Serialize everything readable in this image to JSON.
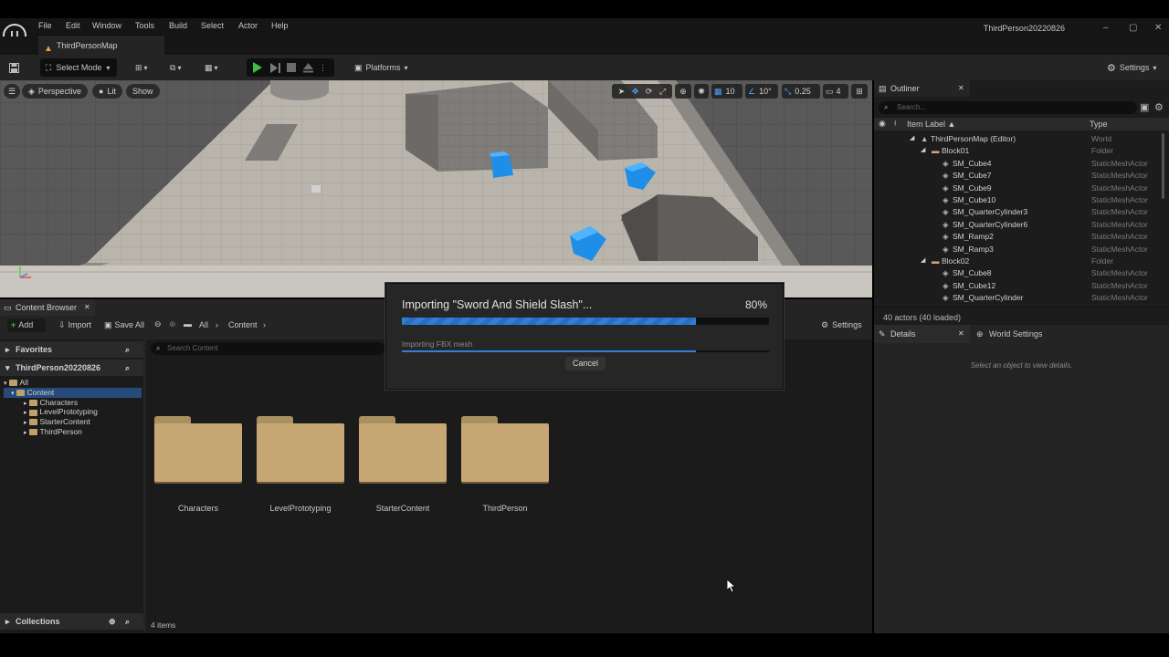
{
  "app": {
    "logo": "U",
    "project_name": "ThirdPerson20220826"
  },
  "menu": [
    "File",
    "Edit",
    "Window",
    "Tools",
    "Build",
    "Select",
    "Actor",
    "Help"
  ],
  "window_controls": {
    "minimize": "–",
    "restore": "▢",
    "close": "✕"
  },
  "map_tab": {
    "label": "ThirdPersonMap",
    "icon": "level-icon"
  },
  "toolbar": {
    "save_icon": "save-icon",
    "mode_label": "Select Mode",
    "platforms_label": "Platforms",
    "settings_label": "Settings"
  },
  "viewport": {
    "perspective_label": "Perspective",
    "lit_label": "Lit",
    "show_label": "Show",
    "grid_snap": "10",
    "rotation_snap": "10°",
    "scale_snap": "0.25",
    "camera_speed": "4"
  },
  "outliner": {
    "tab_label": "Outliner",
    "search_placeholder": "Search...",
    "col_label": "Item Label ▲",
    "col_type": "Type",
    "rows": [
      {
        "label": "ThirdPersonMap (Editor)",
        "type": "World",
        "indent": 0,
        "kind": "world"
      },
      {
        "label": "Block01",
        "type": "Folder",
        "indent": 1,
        "kind": "folder"
      },
      {
        "label": "SM_Cube4",
        "type": "StaticMeshActor",
        "indent": 2,
        "kind": "mesh"
      },
      {
        "label": "SM_Cube7",
        "type": "StaticMeshActor",
        "indent": 2,
        "kind": "mesh"
      },
      {
        "label": "SM_Cube9",
        "type": "StaticMeshActor",
        "indent": 2,
        "kind": "mesh"
      },
      {
        "label": "SM_Cube10",
        "type": "StaticMeshActor",
        "indent": 2,
        "kind": "mesh"
      },
      {
        "label": "SM_QuarterCylinder3",
        "type": "StaticMeshActor",
        "indent": 2,
        "kind": "mesh"
      },
      {
        "label": "SM_QuarterCylinder6",
        "type": "StaticMeshActor",
        "indent": 2,
        "kind": "mesh"
      },
      {
        "label": "SM_Ramp2",
        "type": "StaticMeshActor",
        "indent": 2,
        "kind": "mesh"
      },
      {
        "label": "SM_Ramp3",
        "type": "StaticMeshActor",
        "indent": 2,
        "kind": "mesh"
      },
      {
        "label": "Block02",
        "type": "Folder",
        "indent": 1,
        "kind": "folder"
      },
      {
        "label": "SM_Cube8",
        "type": "StaticMeshActor",
        "indent": 2,
        "kind": "mesh"
      },
      {
        "label": "SM_Cube12",
        "type": "StaticMeshActor",
        "indent": 2,
        "kind": "mesh"
      },
      {
        "label": "SM_QuarterCylinder",
        "type": "StaticMeshActor",
        "indent": 2,
        "kind": "mesh"
      }
    ],
    "status": "40 actors (40 loaded)"
  },
  "details": {
    "tab_label": "Details",
    "world_settings_label": "World Settings",
    "empty_hint": "Select an object to view details."
  },
  "content_browser": {
    "tab_label": "Content Browser",
    "add_label": "Add",
    "import_label": "Import",
    "save_all_label": "Save All",
    "path": [
      "All",
      "Content"
    ],
    "settings_label": "Settings",
    "favorites_label": "Favorites",
    "project_label": "ThirdPerson20220826",
    "search_placeholder": "Search Content",
    "tree": [
      {
        "label": "All",
        "indent": 0,
        "selected": false
      },
      {
        "label": "Content",
        "indent": 1,
        "selected": true
      },
      {
        "label": "Characters",
        "indent": 2,
        "selected": false
      },
      {
        "label": "LevelPrototyping",
        "indent": 2,
        "selected": false
      },
      {
        "label": "StarterContent",
        "indent": 2,
        "selected": false
      },
      {
        "label": "ThirdPerson",
        "indent": 2,
        "selected": false
      }
    ],
    "folders": [
      "Characters",
      "LevelPrototyping",
      "StarterContent",
      "ThirdPerson"
    ],
    "collections_label": "Collections",
    "item_count": "4 items"
  },
  "import_dialog": {
    "title": "Importing \"Sword And Shield Slash\"...",
    "percent_label": "80%",
    "progress": 0.8,
    "sub_label": "Importing FBX mesh",
    "sub_progress": 0.8,
    "cancel_label": "Cancel"
  },
  "colors": {
    "accent": "#2f7fd8",
    "play": "#3fbf3f",
    "folder": "#c7a874",
    "selected_row": "#264b7a",
    "cube_blue": "#1f8ee8"
  }
}
